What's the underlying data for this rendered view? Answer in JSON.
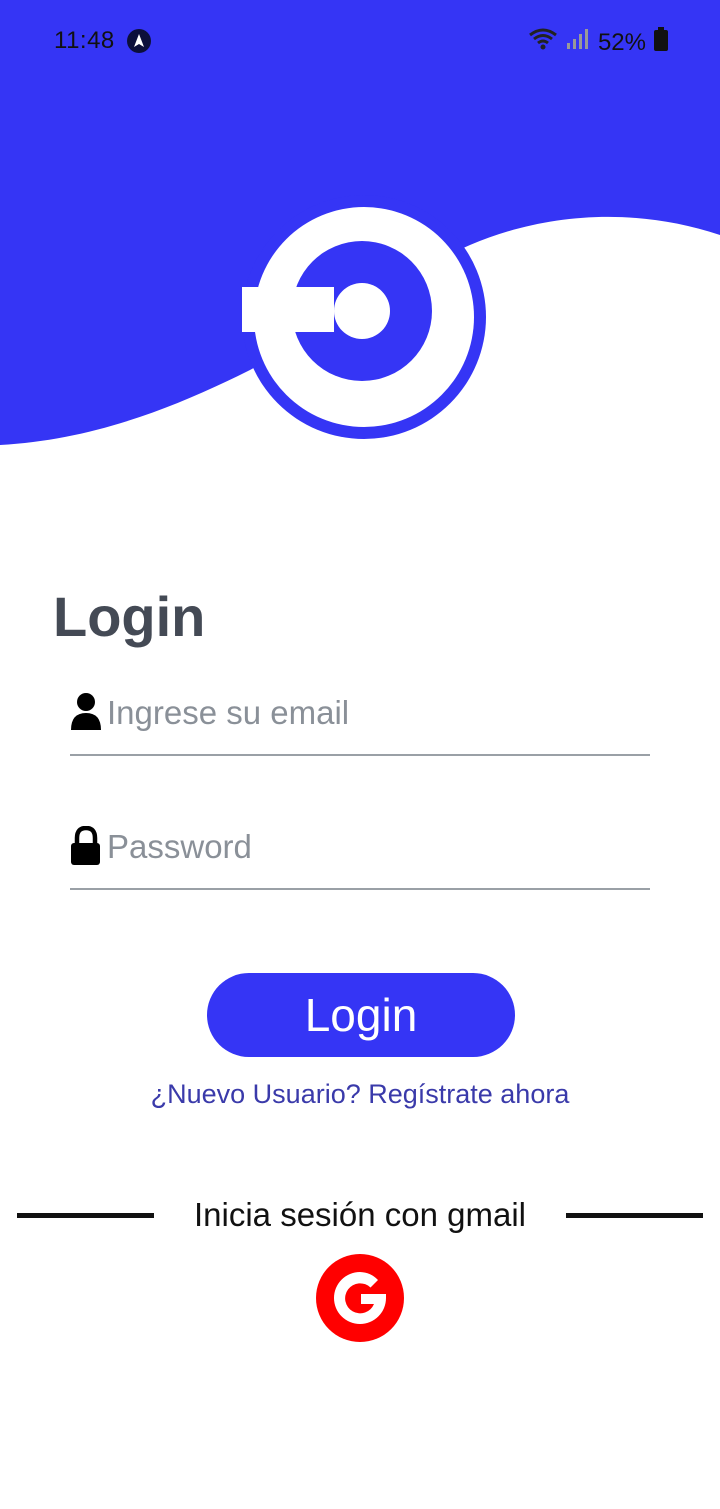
{
  "status_bar": {
    "time": "11:48",
    "battery_percent": "52%",
    "app_icon": "navigation-app-icon",
    "wifi_icon": "wifi-icon",
    "signal_icon": "cell-signal-icon",
    "battery_icon": "battery-icon"
  },
  "colors": {
    "brand_blue": "#3535f5",
    "title_gray": "#444a55",
    "link_blue": "#3a3aaa",
    "google_red": "#ff0000"
  },
  "header": {
    "logo_icon": "app-logo-icon"
  },
  "login": {
    "title": "Login",
    "email_placeholder": "Ingrese su email",
    "email_value": "",
    "email_icon": "user-icon",
    "password_placeholder": "Password",
    "password_value": "",
    "password_icon": "lock-icon",
    "submit_label": "Login",
    "register_link": "¿Nuevo Usuario? Regístrate ahora"
  },
  "social": {
    "divider_text": "Inicia sesión con gmail",
    "google_icon": "google-icon"
  }
}
